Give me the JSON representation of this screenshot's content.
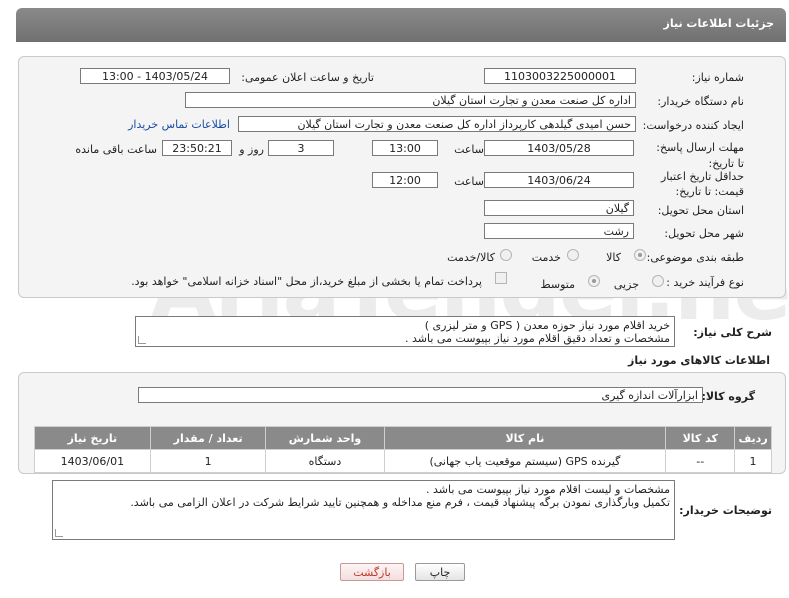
{
  "header": {
    "title": "جزئیات اطلاعات نیاز"
  },
  "form": {
    "need_number_label": "شماره نیاز:",
    "need_number": "1103003225000001",
    "announce_label": "تاریخ و ساعت اعلان عمومی:",
    "announce_value": "1403/05/24 - 13:00",
    "buyer_org_label": "نام دستگاه خریدار:",
    "buyer_org": "اداره کل صنعت  معدن و تجارت استان گیلان",
    "creator_label": "ایجاد کننده درخواست:",
    "creator": "حسن امیدی گیلدهی کارپرداز اداره کل صنعت  معدن و تجارت استان گیلان",
    "contact_link": "اطلاعات تماس خریدار",
    "deadline_label": "مهلت ارسال پاسخ: تا تاریخ:",
    "deadline_date": "1403/05/28",
    "time_label": "ساعت",
    "deadline_time": "13:00",
    "days_value": "3",
    "days_label": "روز و",
    "remaining_time": "23:50:21",
    "remaining_label": "ساعت باقی مانده",
    "validity_label": "حداقل تاریخ اعتبار قیمت: تا تاریخ:",
    "validity_date": "1403/06/24",
    "validity_time": "12:00",
    "province_label": "استان محل تحویل:",
    "province": "گیلان",
    "city_label": "شهر محل تحویل:",
    "city": "رشت",
    "category_label": "طبقه بندی موضوعی:",
    "category_options": [
      "کالا",
      "خدمت",
      "کالا/خدمت"
    ],
    "purchase_type_label": "نوع فرآیند خرید :",
    "purchase_options": [
      "جزیی",
      "متوسط"
    ],
    "payment_note": "پرداخت تمام یا بخشی از مبلغ خرید،از محل \"اسناد خزانه اسلامی\" خواهد بود."
  },
  "description": {
    "label": "شرح کلی نیاز:",
    "line1": "خرید اقلام مورد نیاز حوزه معدن ( GPS  و متر لیزری )",
    "line2": "مشخصات و تعداد دقیق اقلام مورد نیاز بپیوست می باشد ."
  },
  "goods": {
    "section_title": "اطلاعات کالاهای مورد نیاز",
    "group_label": "گروه کالا:",
    "group_value": "ابزارآلات اندازه گیری",
    "columns": [
      "ردیف",
      "کد کالا",
      "نام کالا",
      "واحد شمارش",
      "تعداد / مقدار",
      "تاریخ نیاز"
    ],
    "rows": [
      {
        "row": "1",
        "code": "--",
        "name": "گیرنده GPS (سیستم موقعیت یاب جهانی)",
        "unit": "دستگاه",
        "qty": "1",
        "date": "1403/06/01"
      }
    ]
  },
  "buyer_notes": {
    "label": "توضیحات خریدار:",
    "line1": "مشخصات و لیست اقلام مورد نیاز بپیوست می باشد .",
    "line2": "تکمیل وبارگذاری نمودن برگه پیشنهاد قیمت ، فرم منع مداخله و همچنین تایید شرایط شرکت در اعلان الزامی می باشد."
  },
  "buttons": {
    "print": "چاپ",
    "back": "بازگشت"
  },
  "watermark": "AriaTender.neT"
}
